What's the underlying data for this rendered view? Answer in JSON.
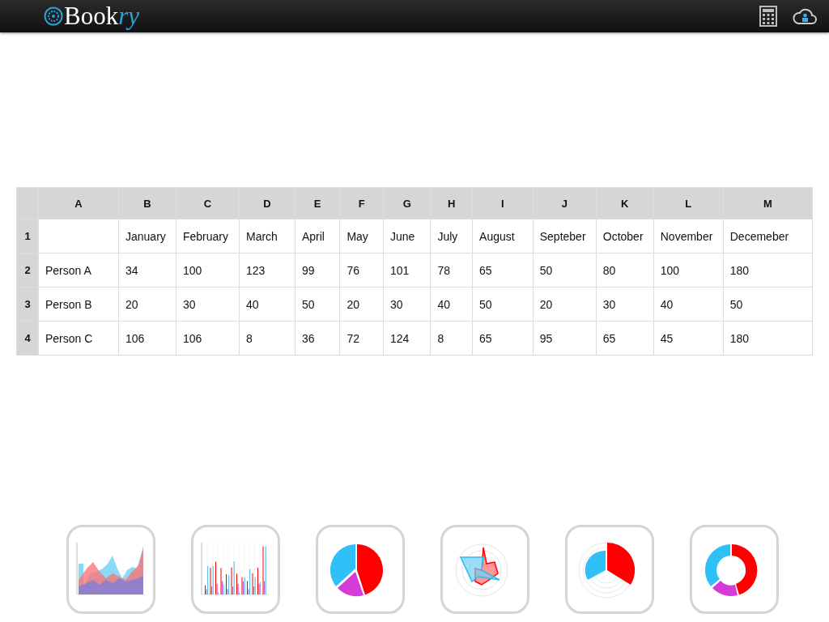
{
  "header": {
    "logo": {
      "main": "Book",
      "accent": "ry"
    }
  },
  "sheet": {
    "columns": [
      "A",
      "B",
      "C",
      "D",
      "E",
      "F",
      "G",
      "H",
      "I",
      "J",
      "K",
      "L",
      "M"
    ],
    "rows": [
      {
        "number": "1",
        "cells": [
          "",
          "January",
          "February",
          "March",
          "April",
          "May",
          "June",
          "July",
          "August",
          "Septeber",
          "October",
          "November",
          "Decemeber"
        ]
      },
      {
        "number": "2",
        "cells": [
          "Person A",
          "34",
          "100",
          "123",
          "99",
          "76",
          "101",
          "78",
          "65",
          "50",
          "80",
          "100",
          "180"
        ]
      },
      {
        "number": "3",
        "cells": [
          "Person B",
          "20",
          "30",
          "40",
          "50",
          "20",
          "30",
          "40",
          "50",
          "20",
          "30",
          "40",
          "50"
        ]
      },
      {
        "number": "4",
        "cells": [
          "Person C",
          "106",
          "106",
          "8",
          "36",
          "72",
          "124",
          "8",
          "65",
          "95",
          "65",
          "45",
          "180"
        ]
      }
    ]
  },
  "chart_buttons": [
    {
      "kind": "area"
    },
    {
      "kind": "bar"
    },
    {
      "kind": "pie"
    },
    {
      "kind": "radar"
    },
    {
      "kind": "polar"
    },
    {
      "kind": "doughnut"
    }
  ]
}
